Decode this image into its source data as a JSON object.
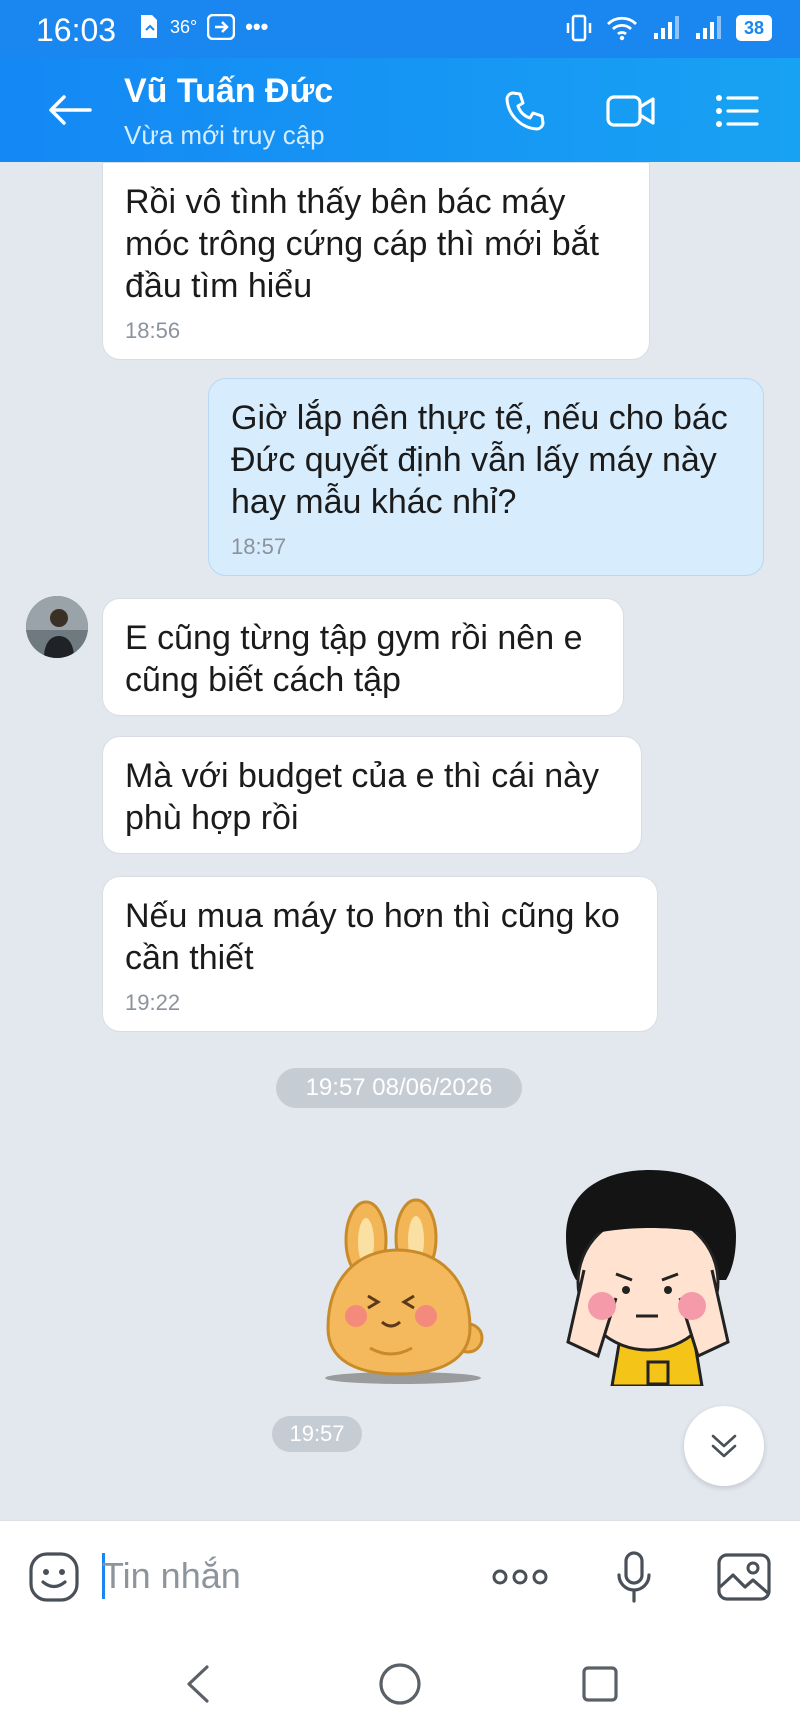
{
  "status_bar": {
    "time": "16:03",
    "temperature": "36°",
    "more": "•••",
    "battery": "38"
  },
  "header": {
    "contact_name": "Vũ Tuấn Đức",
    "contact_status": "Vừa mới truy cập",
    "accent_color": "#1a86f0"
  },
  "messages": [
    {
      "direction": "received",
      "text_lines": [
        "Rồi vô tình thấy bên bác máy",
        "móc trông cứng cáp thì mới bắt",
        "đầu tìm hiểu"
      ],
      "time": "18:56"
    },
    {
      "direction": "sent",
      "text_lines": [
        "Giờ lắp nên thực tế, nếu cho bác",
        "Đức quyết định vẫn lấy máy này",
        "hay mẫu khác nhỉ?"
      ],
      "time": "18:57"
    },
    {
      "direction": "received",
      "text_lines": [
        "E cũng từng tập gym rồi nên e",
        "cũng biết cách tập"
      ],
      "time": ""
    },
    {
      "direction": "received",
      "text_lines": [
        "Mà với budget của e thì cái này",
        "phù hợp rồi"
      ],
      "time": ""
    },
    {
      "direction": "received",
      "text_lines": [
        "Nếu mua máy to hơn thì cũng ko",
        "cần thiết"
      ],
      "time": "19:22"
    }
  ],
  "date_separator": "19:57 08/06/2026",
  "stickers": [
    {
      "name": "bunny-sticker",
      "description_icon": "bunny-icon"
    },
    {
      "name": "girl-sticker",
      "description_icon": "girl-icon"
    }
  ],
  "sticker_time": "19:57",
  "input": {
    "placeholder": "Tin nhắn",
    "value": ""
  },
  "icons": {
    "back": "arrow-left-icon",
    "call": "phone-icon",
    "video": "video-camera-icon",
    "menu": "list-icon",
    "emoji": "emoji-icon",
    "more": "more-dots-icon",
    "mic": "microphone-icon",
    "image": "image-icon",
    "scroll": "chevron-double-down-icon"
  }
}
